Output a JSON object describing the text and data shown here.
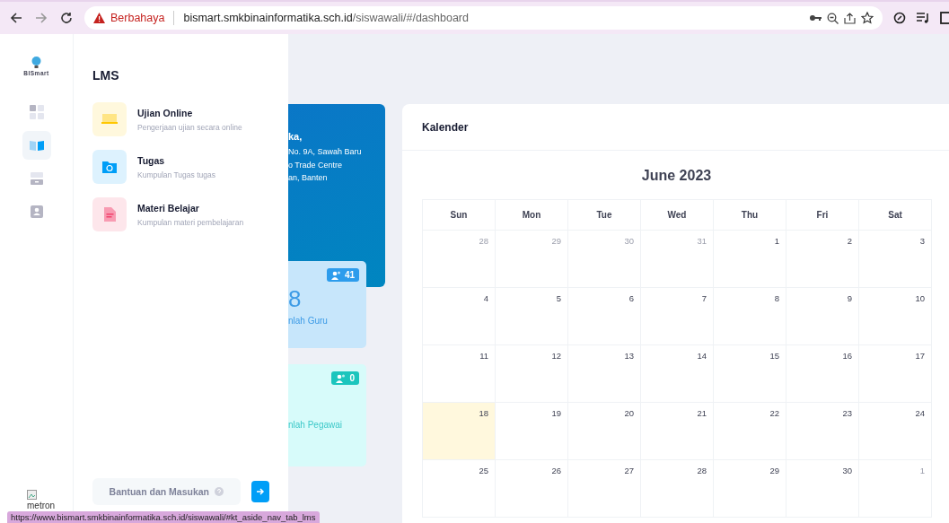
{
  "browser": {
    "security_label": "Berbahaya",
    "url_host": "bismart.smkbinainformatika.sch.id",
    "url_path": "/siswawali/#/dashboard"
  },
  "rail": {
    "logo_text": "BISmart",
    "nav": [
      {
        "selected": false
      },
      {
        "selected": true
      },
      {
        "selected": false
      },
      {
        "selected": false
      }
    ],
    "broken_image_alt": "metron"
  },
  "panel": {
    "title": "LMS",
    "items": [
      {
        "color": "#ffc700",
        "title": "Ujian Online",
        "subtitle": "Pengerjaan ujian secara online"
      },
      {
        "color": "#009ef7",
        "title": "Tugas",
        "subtitle": "Kumpulan Tugas tugas"
      },
      {
        "color": "#f1416c",
        "title": "Materi Belajar",
        "subtitle": "Kumpulan materi pembelajaran"
      }
    ],
    "help_button": "Bantuan dan Masukan"
  },
  "welcome_card": {
    "title": "ka,",
    "lines": [
      "No. 9A, Sawah Baru",
      "o Trade Centre",
      "an, Banten"
    ]
  },
  "stat_cards": [
    {
      "kind": "blue",
      "badge": "41",
      "value": "8",
      "label": "nlah Guru"
    },
    {
      "kind": "teal",
      "badge": "0",
      "label": "nlah Pegawai"
    }
  ],
  "calendar": {
    "title": "Kalender",
    "month": "June 2023",
    "weekdays": [
      "Sun",
      "Mon",
      "Tue",
      "Wed",
      "Thu",
      "Fri",
      "Sat"
    ],
    "weeks": [
      [
        {
          "day": "28",
          "outside": true,
          "today": false
        },
        {
          "day": "29",
          "outside": true,
          "today": false
        },
        {
          "day": "30",
          "outside": true,
          "today": false
        },
        {
          "day": "31",
          "outside": true,
          "today": false
        },
        {
          "day": "1",
          "outside": false,
          "today": false
        },
        {
          "day": "2",
          "outside": false,
          "today": false
        },
        {
          "day": "3",
          "outside": false,
          "today": false
        }
      ],
      [
        {
          "day": "4",
          "outside": false,
          "today": false
        },
        {
          "day": "5",
          "outside": false,
          "today": false
        },
        {
          "day": "6",
          "outside": false,
          "today": false
        },
        {
          "day": "7",
          "outside": false,
          "today": false
        },
        {
          "day": "8",
          "outside": false,
          "today": false
        },
        {
          "day": "9",
          "outside": false,
          "today": false
        },
        {
          "day": "10",
          "outside": false,
          "today": false
        }
      ],
      [
        {
          "day": "11",
          "outside": false,
          "today": false
        },
        {
          "day": "12",
          "outside": false,
          "today": false
        },
        {
          "day": "13",
          "outside": false,
          "today": false
        },
        {
          "day": "14",
          "outside": false,
          "today": false
        },
        {
          "day": "15",
          "outside": false,
          "today": false
        },
        {
          "day": "16",
          "outside": false,
          "today": false
        },
        {
          "day": "17",
          "outside": false,
          "today": false
        }
      ],
      [
        {
          "day": "18",
          "outside": false,
          "today": true
        },
        {
          "day": "19",
          "outside": false,
          "today": false
        },
        {
          "day": "20",
          "outside": false,
          "today": false
        },
        {
          "day": "21",
          "outside": false,
          "today": false
        },
        {
          "day": "22",
          "outside": false,
          "today": false
        },
        {
          "day": "23",
          "outside": false,
          "today": false
        },
        {
          "day": "24",
          "outside": false,
          "today": false
        }
      ],
      [
        {
          "day": "25",
          "outside": false,
          "today": false
        },
        {
          "day": "26",
          "outside": false,
          "today": false
        },
        {
          "day": "27",
          "outside": false,
          "today": false
        },
        {
          "day": "28",
          "outside": false,
          "today": false
        },
        {
          "day": "29",
          "outside": false,
          "today": false
        },
        {
          "day": "30",
          "outside": false,
          "today": false
        },
        {
          "day": "1",
          "outside": true,
          "today": false
        }
      ]
    ]
  },
  "status_url": "https://www.bismart.smkbinainformatika.sch.id/siswawali/#kt_aside_nav_tab_lms"
}
